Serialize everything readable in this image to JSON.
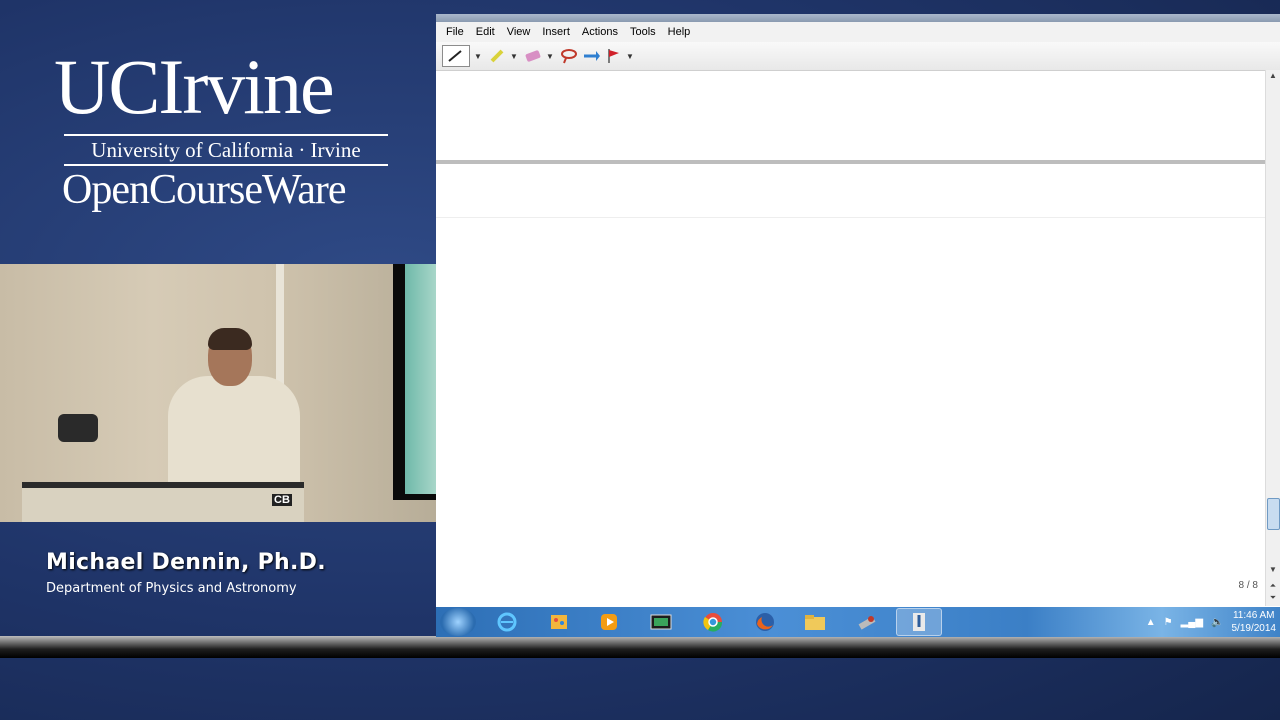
{
  "branding": {
    "logo_main": "UCIrvine",
    "logo_univ": "University of California · Irvine",
    "logo_ocw": "OpenCourseWare"
  },
  "video": {
    "caption_badge": "CB"
  },
  "speaker": {
    "name": "Michael Dennin, Ph.D.",
    "department": "Department of Physics and Astronomy"
  },
  "app": {
    "menu": [
      "File",
      "Edit",
      "View",
      "Insert",
      "Actions",
      "Tools",
      "Help"
    ],
    "toolbar_icons": [
      "pen-icon",
      "highlighter-icon",
      "eraser-icon",
      "lasso-icon",
      "insert-space-icon",
      "flag-icon"
    ],
    "page_counter": "8 / 8"
  },
  "taskbar": {
    "apps": [
      "internet-explorer-icon",
      "paint-icon",
      "media-player-icon",
      "screen-icon",
      "chrome-icon",
      "firefox-icon",
      "file-explorer-icon",
      "tool-icon",
      "journal-icon"
    ],
    "clock_time": "11:46 AM",
    "clock_date": "5/19/2014"
  },
  "colors": {
    "background": "#1f3468",
    "taskbar": "#3b7fc6",
    "text": "#ffffff"
  }
}
